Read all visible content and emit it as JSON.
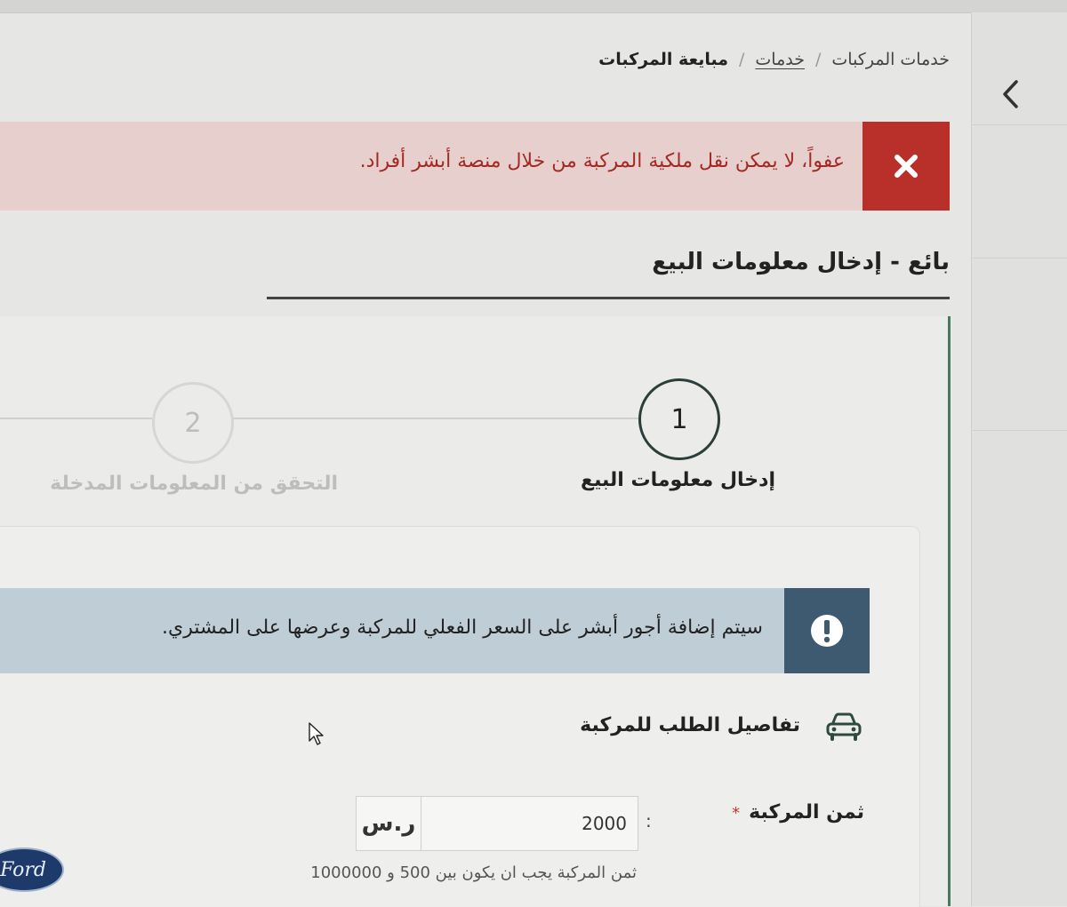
{
  "breadcrumb": {
    "home": "خدمات المركبات",
    "services": "خدمات",
    "current": "مبايعة المركبات",
    "separator": "/"
  },
  "error_alert": {
    "message": "عفواً، لا يمكن نقل ملكية المركبة من خلال منصة أبشر أفراد.",
    "icon": "close-icon",
    "color": "#b83029"
  },
  "section": {
    "title": "بائع - إدخال معلومات البيع"
  },
  "steps": [
    {
      "number": "1",
      "label": "إدخال معلومات البيع",
      "state": "active"
    },
    {
      "number": "2",
      "label": "التحقق من المعلومات المدخلة",
      "state": "inactive"
    }
  ],
  "info_alert": {
    "message": "سيتم إضافة أجور أبشر على السعر الفعلي للمركبة وعرضها على المشتري.",
    "icon": "exclamation-icon",
    "color": "#3e5a70"
  },
  "details": {
    "header": "تفاصيل الطلب للمركبة",
    "icon": "car-icon"
  },
  "price": {
    "label": "ثمن المركبة",
    "required_mark": "*",
    "colon": ":",
    "value": "2000",
    "currency": "ر.س",
    "hint": "ثمن المركبة يجب ان يكون بين 500 و 1000000"
  },
  "logo": {
    "text": "Ford"
  }
}
